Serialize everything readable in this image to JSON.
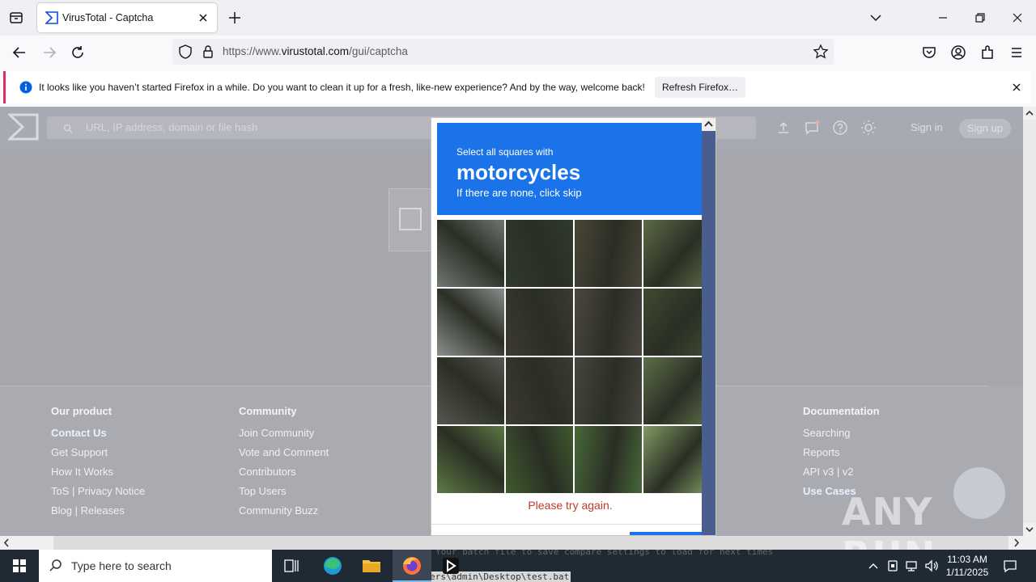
{
  "browser": {
    "tab_title": "VirusTotal - Captcha",
    "url_prefix": "https://www.",
    "url_domain": "virustotal.com",
    "url_path": "/gui/captcha"
  },
  "notification": {
    "text": "It looks like you haven’t started Firefox in a while. Do you want to clean it up for a fresh, like-new experience? And by the way, welcome back!",
    "button": "Refresh Firefox…"
  },
  "vt": {
    "search_placeholder": "URL, IP address, domain or file hash",
    "sign_in": "Sign in",
    "sign_up": "Sign up"
  },
  "footer": {
    "columns": [
      {
        "title": "Our product",
        "items": [
          "Contact Us",
          "Get Support",
          "How It Works",
          "ToS | Privacy Notice",
          "Blog | Releases"
        ]
      },
      {
        "title": "Community",
        "items": [
          "Join Community",
          "Vote and Comment",
          "Contributors",
          "Top Users",
          "Community Buzz"
        ]
      },
      {
        "title": "Documentation",
        "items": [
          "Searching",
          "Reports",
          "API v3 | v2",
          "Use Cases"
        ]
      }
    ]
  },
  "captcha": {
    "small": "Select all squares with",
    "big": "motorcycles",
    "sub": "If there are none, click skip",
    "error": "Please try again.",
    "grid_rows": 4,
    "grid_cols": 4
  },
  "watermark": "ANY RUN",
  "taskbar": {
    "search_placeholder": "Type here to search",
    "time": "11:03 AM",
    "date": "1/11/2025",
    "cmd_line1": "Your batch file to save compare settings to load for next times",
    "cmd_line2": "C:\\Users\\admin\\Desktop\\test.bat"
  },
  "colors": {
    "captcha_blue": "#1a73e8",
    "error_red": "#c0392b",
    "overlay_gray": "#a6a7ac"
  }
}
